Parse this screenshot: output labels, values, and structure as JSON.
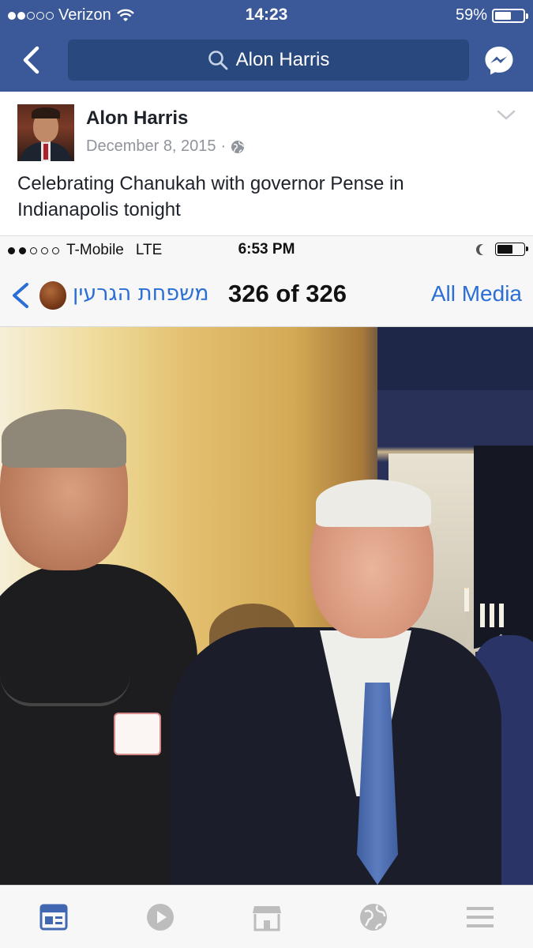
{
  "status_bar": {
    "carrier": "Verizon",
    "time": "14:23",
    "battery_percent": "59%",
    "battery_level": 0.59,
    "signal_bars": 2
  },
  "nav": {
    "search_text": "Alon Harris",
    "icons": [
      "back-chevron-icon",
      "search-icon",
      "messenger-icon"
    ],
    "color": "#3b5998"
  },
  "post": {
    "author": "Alon Harris",
    "date": "December 8, 2015",
    "separator": "·",
    "privacy_icon": "globe-icon",
    "text": "Celebrating Chanukah with governor Pense in Indianapolis tonight"
  },
  "shared_screenshot": {
    "status": {
      "carrier": "T-Mobile",
      "network": "LTE",
      "time": "6:53 PM",
      "battery_level": 0.6
    },
    "nav": {
      "album_title": "משפחת הגרעין",
      "counter": "326 of 326",
      "all_media_label": "All Media"
    }
  },
  "tab_bar": {
    "tabs": [
      "news-feed-icon",
      "video-icon",
      "marketplace-icon",
      "notifications-globe-icon",
      "menu-icon"
    ],
    "active_tab": "news-feed-icon",
    "active_color": "#4267b2",
    "inactive_color": "#bdbdbd"
  }
}
